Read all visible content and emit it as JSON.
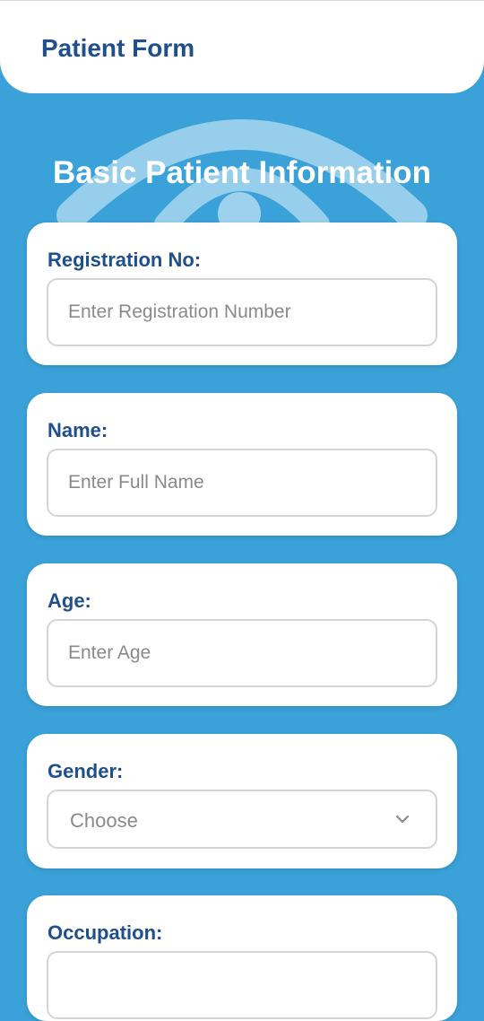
{
  "header": {
    "title": "Patient Form"
  },
  "hero": {
    "title": "Basic Patient Information"
  },
  "form": {
    "registration": {
      "label": "Registration No:",
      "placeholder": "Enter Registration Number"
    },
    "name": {
      "label": "Name:",
      "placeholder": "Enter Full Name"
    },
    "age": {
      "label": "Age:",
      "placeholder": "Enter Age"
    },
    "gender": {
      "label": "Gender:",
      "selected": "Choose"
    },
    "occupation": {
      "label": "Occupation:"
    }
  },
  "icons": {
    "watermark": "eye-icon",
    "dropdown": "chevron-down-icon"
  },
  "colors": {
    "background": "#3aa2d8",
    "header_text": "#1f4f8c",
    "card": "#ffffff",
    "placeholder": "#8a8a8a"
  }
}
